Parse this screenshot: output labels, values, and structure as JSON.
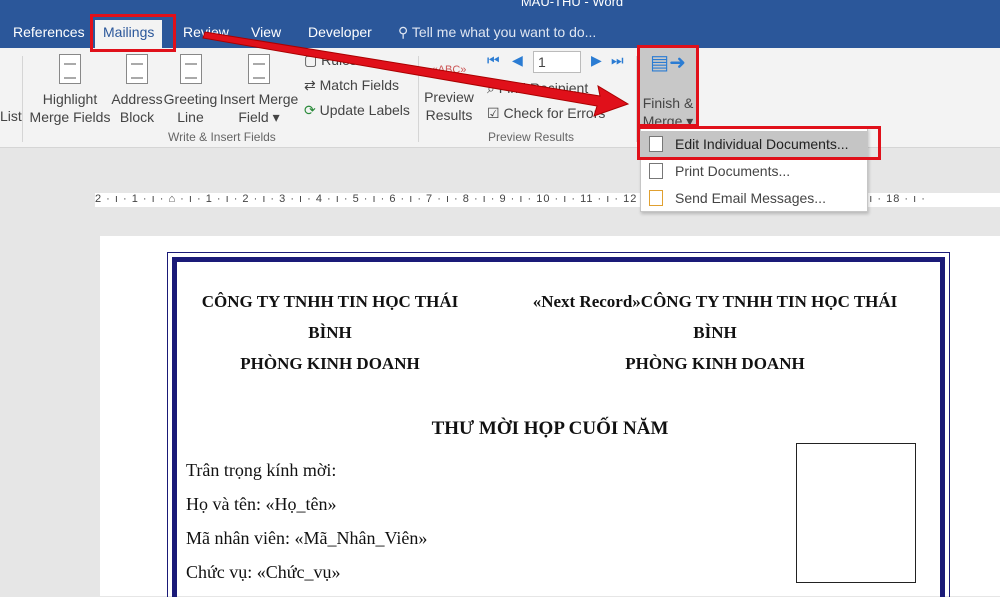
{
  "title": "MAU-THU - Word",
  "tabs": [
    "References",
    "Mailings",
    "Review",
    "View",
    "Developer"
  ],
  "tell_me": "Tell me what you want to do...",
  "ribbon": {
    "list_cut": "List",
    "highlight": [
      "Highlight",
      "Merge Fields"
    ],
    "address": [
      "Address",
      "Block"
    ],
    "greeting": [
      "Greeting",
      "Line"
    ],
    "insert": [
      "Insert Merge",
      "Field ▾"
    ],
    "rules": "Rules",
    "match": "Match Fields",
    "update": "Update Labels",
    "group1": "Write & Insert Fields",
    "preview": [
      "Preview",
      "Results"
    ],
    "record": "1",
    "find": "Find Recipient",
    "check": "Check for Errors",
    "group2": "Preview Results",
    "finish": [
      "Finish &",
      "Merge ▾"
    ]
  },
  "menu": [
    "Edit Individual Documents...",
    "Print Documents...",
    "Send Email Messages..."
  ],
  "ruler": "2 · ı · 1 · ı · ⌂ · ı · 1 · ı · 2 · ı · 3 · ı · 4 · ı · 5 · ı · 6 · ı · 7 · ı · 8 · ı · 9 · ı · 10 · ı · 11 · ı · 12 · ı · 13 · ı · 14 · ı · 15 · ı · 16 · ı · 17 · ı · 18 · ı ·",
  "letter": {
    "left": [
      "CÔNG TY TNHH TIN HỌC THÁI",
      "BÌNH",
      "PHÒNG KINH DOANH"
    ],
    "right": [
      "«Next Record»CÔNG TY TNHH TIN HỌC THÁI",
      "BÌNH",
      "PHÒNG KINH DOANH"
    ],
    "heading": "THƯ MỜI HỌP CUỐI NĂM",
    "lines": [
      "Trân trọng kính mời:",
      "Họ và tên: «Họ_tên»",
      "Mã nhân viên: «Mã_Nhân_Viên»",
      "Chức vụ: «Chức_vụ»"
    ]
  }
}
